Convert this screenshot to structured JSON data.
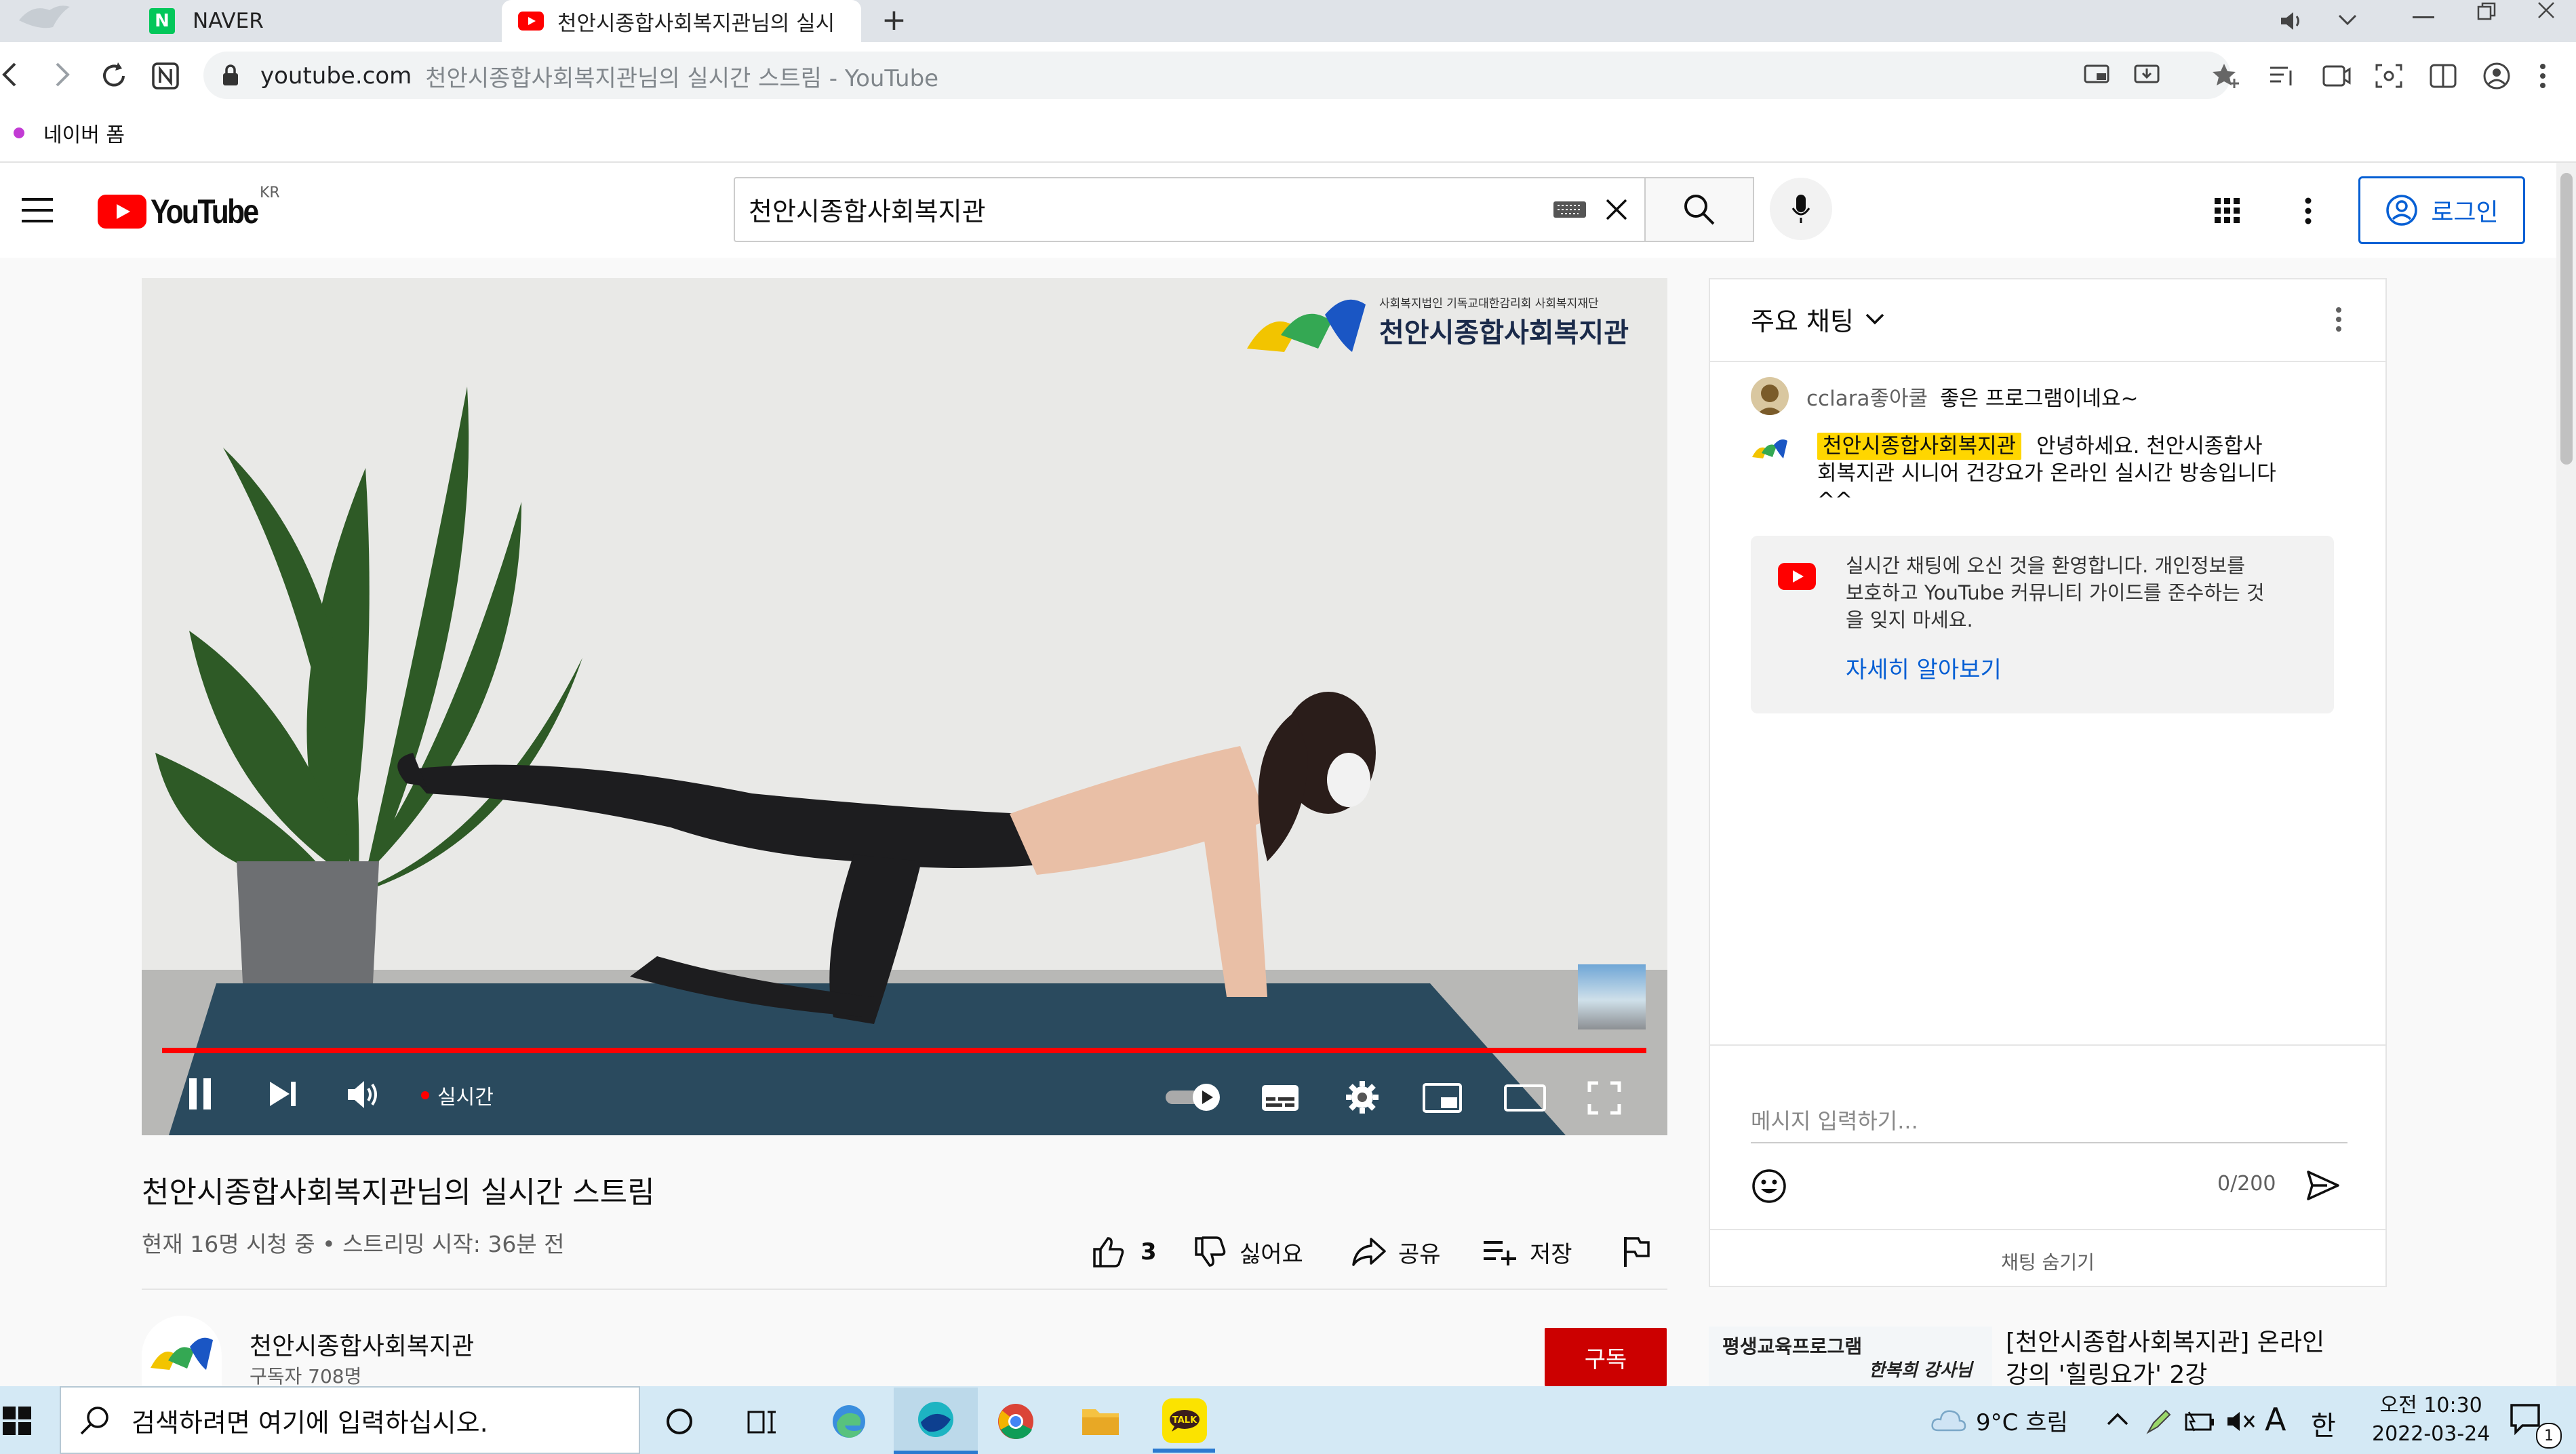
{
  "browser": {
    "tabs": [
      {
        "label": "NAVER",
        "favicon": "naver-n-icon"
      },
      {
        "label": "천안시종합사회복지관님의 실시",
        "favicon": "youtube-icon"
      }
    ],
    "new_tab": "+",
    "url_domain": "youtube.com",
    "url_title": "천안시종합사회복지관님의 실시간 스트림 - YouTube",
    "bookmark": "네이버 폼",
    "colors": {
      "tabbar": "#dfe3e8",
      "active_tab": "#ffffff"
    }
  },
  "youtube": {
    "logo_text": "YouTube",
    "region": "KR",
    "search_value": "천안시종합사회복지관",
    "login_label": "로그인",
    "brand_red": "#ff0000",
    "link_blue": "#065fd4"
  },
  "video": {
    "overlay_org_line": "사회복지법인 기독교대한감리회 사회복지재단",
    "overlay_org_name": "천안시종합사회복지관",
    "live_label": "실시간",
    "progress_fraction": 0.985
  },
  "video_info": {
    "title": "천안시종합사회복지관님의 실시간 스트림",
    "meta": "현재 16명 시청 중 • 스트리밍 시작: 36분 전",
    "like_count": "3",
    "dislike_label": "싫어요",
    "share_label": "공유",
    "save_label": "저장",
    "channel_name": "천안시종합사회복지관",
    "subscribers": "구독자 708명",
    "subscribe_label": "구독"
  },
  "chat": {
    "header": "주요 채팅",
    "messages": [
      {
        "author": "cclara좋아쿨",
        "text": "좋은 프로그램이네요~",
        "owner": false
      },
      {
        "author": "천안시종합사회복지관",
        "text_line1": "안녕하세요. 천안시종합사",
        "text_line2": "회복지관 시니어 건강요가 온라인 실시간 방송입니다",
        "text_line3": "^^",
        "owner": true
      }
    ],
    "notice_line1": "실시간 채팅에 오신 것을 환영합니다. 개인정보를",
    "notice_line2": "보호하고 YouTube 커뮤니티 가이드를 준수하는 것",
    "notice_line3": "을 잊지 마세요.",
    "learn_more": "자세히 알아보기",
    "input_placeholder": "메시지 입력하기...",
    "char_count": "0/200",
    "hide_chat": "채팅 숨기기"
  },
  "recommendation": {
    "thumb_text1": "평생교육프로그램",
    "thumb_text2": "한복희 강사님",
    "title_line1": "[천안시종합사회복지관] 온라인",
    "title_line2": "강의 '힐링요가' 2강"
  },
  "taskbar": {
    "search_placeholder": "검색하려면 여기에 입력하십시오.",
    "weather": "9°C 흐림",
    "ime_a": "A",
    "ime_lang": "한",
    "time": "오전 10:30",
    "date": "2022-03-24",
    "notification_count": "1"
  }
}
